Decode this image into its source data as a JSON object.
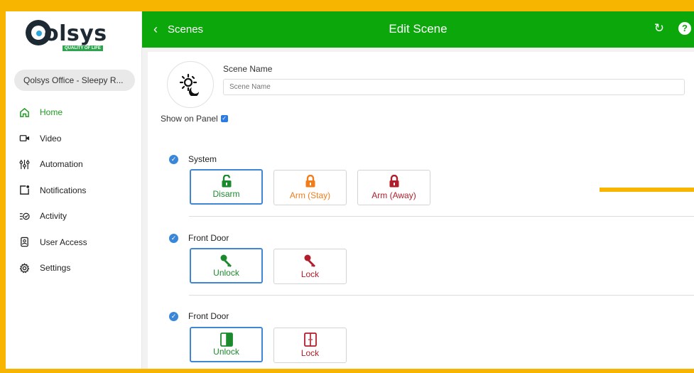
{
  "app": {
    "logo_text": "olsys",
    "logo_tagline": "QUALITY OF LIFE"
  },
  "sidebar": {
    "location": "Qolsys Office - Sleepy R...",
    "items": [
      {
        "label": "Home",
        "icon": "home-icon",
        "active": true
      },
      {
        "label": "Video",
        "icon": "video-camera-icon"
      },
      {
        "label": "Automation",
        "icon": "sliders-icon"
      },
      {
        "label": "Notifications",
        "icon": "notification-icon"
      },
      {
        "label": "Activity",
        "icon": "activity-list-icon"
      },
      {
        "label": "User Access",
        "icon": "user-badge-icon"
      },
      {
        "label": "Settings",
        "icon": "gear-icon"
      }
    ]
  },
  "header": {
    "back_label": "Scenes",
    "title": "Edit Scene",
    "refresh_icon": "refresh-icon",
    "help_icon": "help-icon"
  },
  "form": {
    "scene_name_label": "Scene Name",
    "scene_name_placeholder": "Scene Name",
    "scene_name_value": "",
    "show_on_panel_label": "Show on Panel",
    "show_on_panel_checked": true,
    "scene_icon": "sun-moon-icon"
  },
  "sections": [
    {
      "title": "System",
      "checked": true,
      "options": [
        {
          "label": "Disarm",
          "icon": "unlocked-padlock-icon",
          "color": "#1b8a2c",
          "selected": true
        },
        {
          "label": "Arm (Stay)",
          "icon": "padlock-icon",
          "color": "#f07d1a",
          "selected": false
        },
        {
          "label": "Arm (Away)",
          "icon": "padlock-icon",
          "color": "#b21d2b",
          "selected": false
        }
      ]
    },
    {
      "title": "Front Door",
      "checked": true,
      "options": [
        {
          "label": "Unlock",
          "icon": "key-icon",
          "color": "#1b8a2c",
          "selected": true
        },
        {
          "label": "Lock",
          "icon": "key-icon",
          "color": "#b21d2b",
          "selected": false
        }
      ]
    },
    {
      "title": "Front Door",
      "checked": true,
      "options": [
        {
          "label": "Unlock",
          "icon": "door-icon",
          "color": "#1b8a2c",
          "selected": true
        },
        {
          "label": "Lock",
          "icon": "door-icon",
          "color": "#b21d2b",
          "selected": false
        }
      ]
    }
  ],
  "colors": {
    "header_green": "#0ba70b",
    "frame_yellow": "#f7b500",
    "selected_border": "#3f86d6",
    "check_blue": "#3a86d9"
  }
}
